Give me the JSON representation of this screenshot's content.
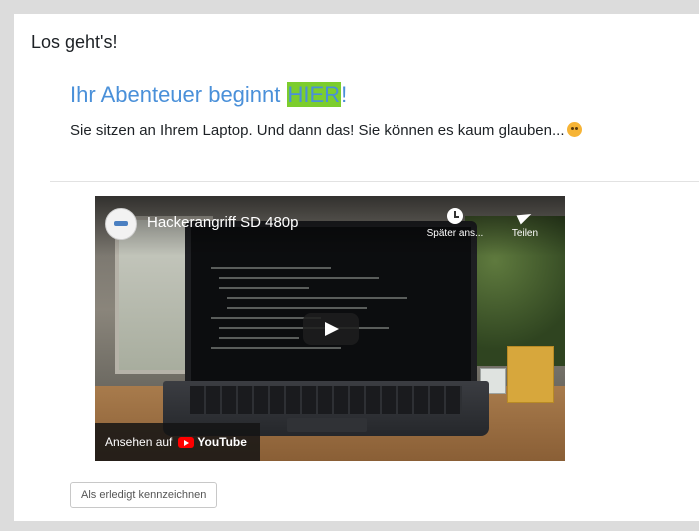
{
  "section": {
    "title": "Los geht's!"
  },
  "content": {
    "headline_before": "Ihr Abenteuer beginnt ",
    "headline_highlight": "HIER",
    "headline_after": "!",
    "subline": "Sie sitzen an Ihrem Laptop. Und dann das! Sie können es kaum glauben...",
    "subline_emoji": "flushed-face-emoji"
  },
  "video": {
    "title": "Hackerangriff SD 480p",
    "watch_later_label": "Später ans...",
    "share_label": "Teilen",
    "watch_on_label": "Ansehen auf",
    "platform_name": "YouTube",
    "icons": [
      "channel-avatar",
      "clock-icon",
      "share-icon",
      "play-icon",
      "youtube-logo"
    ]
  },
  "actions": {
    "mark_complete_label": "Als erledigt kennzeichnen"
  },
  "colors": {
    "link": "#4a90d9",
    "highlight": "#7ccd2d",
    "youtube_red": "#ff0000"
  }
}
